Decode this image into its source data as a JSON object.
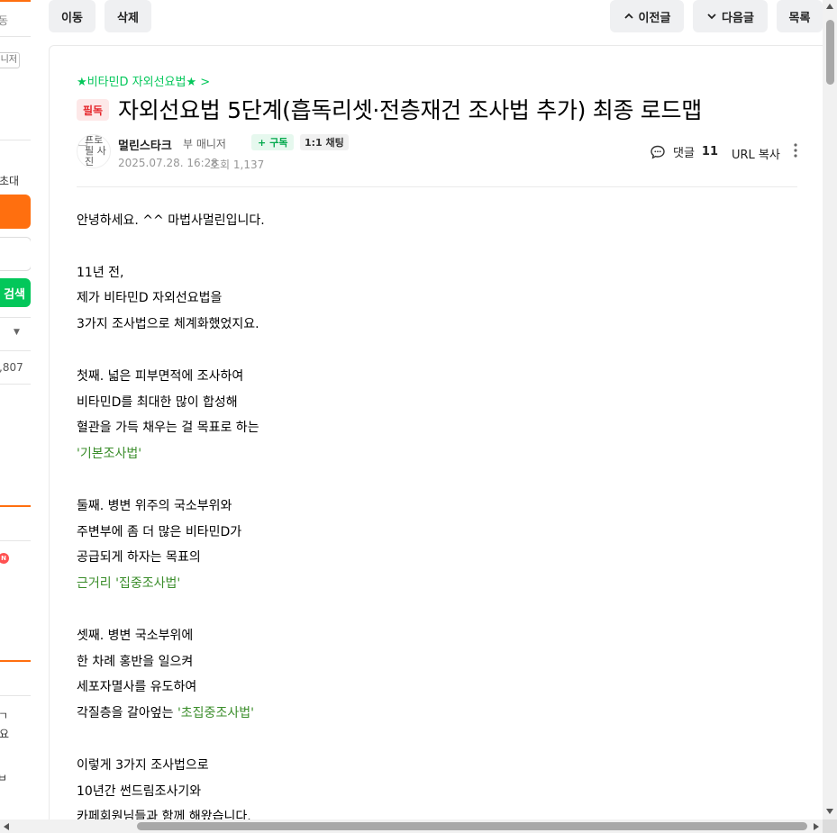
{
  "sidebar": {
    "text_top": "동",
    "manager_box": "니저",
    "invite": "초대",
    "search_button": "검색",
    "count": ",807",
    "new_badge": "N",
    "frag1": "ㄱ",
    "frag2": "요",
    "frag3": "ㅂ"
  },
  "toolbar": {
    "move_label": "이동",
    "delete_label": "삭제",
    "prev_label": "이전글",
    "next_label": "다음글",
    "list_label": "목록"
  },
  "article": {
    "board_link": "★비타민D 자외선요법★ >",
    "tag": "필독",
    "title": "자외선요법 5단계(흡독리셋·전층재건 조사법 추가) 최종 로드맵",
    "avatar_alt": "프로필 사진",
    "author": "멀린스타크",
    "author_level": "부 매니저",
    "subscribe_label": "구독",
    "chat_label": "1:1 채팅",
    "date": "2025.07.28. 16:28",
    "views": "조회 1,137",
    "comment_label": "댓글",
    "comment_count": "11",
    "url_copy": "URL 복사"
  },
  "content_lines": [
    {
      "text": "안녕하세요. ^^ 마법사멀린입니다.",
      "green": false
    },
    {
      "text": "",
      "green": false
    },
    {
      "text": "11년 전,",
      "green": false
    },
    {
      "text": "제가 비타민D 자외선요법을",
      "green": false
    },
    {
      "text": "3가지 조사법으로 체계화했었지요.",
      "green": false
    },
    {
      "text": "",
      "green": false
    },
    {
      "text": "첫째. 넓은 피부면적에 조사하여",
      "green": false
    },
    {
      "text": "비타민D를 최대한 많이 합성해",
      "green": false
    },
    {
      "text": "혈관을 가득 채우는 걸 목표로 하는",
      "green": false
    },
    {
      "text": "'기본조사법'",
      "green": true
    },
    {
      "text": "",
      "green": false
    },
    {
      "text": "둘째. 병변 위주의 국소부위와",
      "green": false
    },
    {
      "text": "주변부에 좀 더 많은 비타민D가",
      "green": false
    },
    {
      "text": "공급되게 하자는 목표의",
      "green": false
    },
    {
      "text": "근거리 '집중조사법'",
      "green": true
    },
    {
      "text": "",
      "green": false
    },
    {
      "text": "셋째. 병변 국소부위에",
      "green": false
    },
    {
      "text": "한 차례 홍반을 일으켜",
      "green": false
    },
    {
      "text": "세포자멸사를 유도하여",
      "green": false
    },
    {
      "text": "각질층을 갈아엎는 ",
      "green": false,
      "suffix": "'초집중조사법'"
    },
    {
      "text": "",
      "green": false
    },
    {
      "text": "이렇게 3가지 조사법으로",
      "green": false
    },
    {
      "text": "10년간 썬드림조사기와",
      "green": false
    },
    {
      "text": "카페회원님들과 함께 해왔습니다.",
      "green": false
    }
  ]
}
